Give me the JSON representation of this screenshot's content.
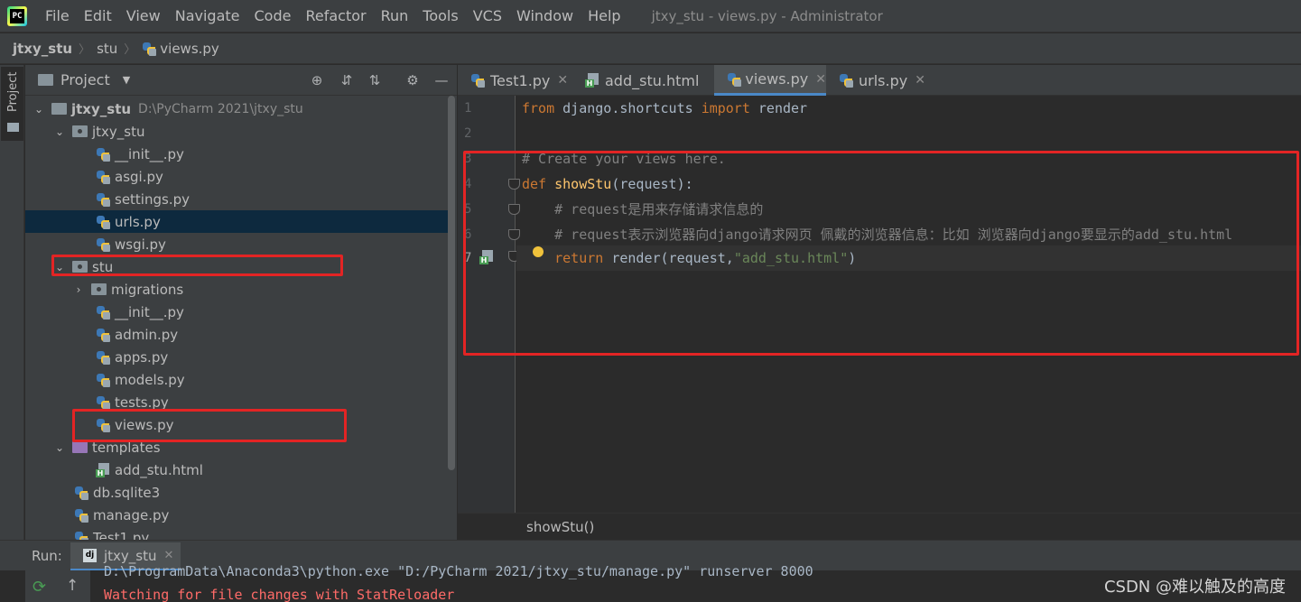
{
  "menubar": {
    "logo_icon": "pycharm-logo",
    "logo_text": "PC",
    "items": [
      "File",
      "Edit",
      "View",
      "Navigate",
      "Code",
      "Refactor",
      "Run",
      "Tools",
      "VCS",
      "Window",
      "Help"
    ],
    "window_title": "jtxy_stu - views.py - Administrator"
  },
  "breadcrumb": {
    "items": [
      "jtxy_stu",
      "stu",
      "views.py"
    ]
  },
  "left_stripe": {
    "label": "Project"
  },
  "project_panel": {
    "title": "Project",
    "tree": [
      {
        "label": "jtxy_stu",
        "path": "D:\\PyCharm 2021\\jtxy_stu",
        "icon": "folder-icon"
      },
      {
        "label": "jtxy_stu",
        "icon": "package-folder-icon"
      },
      {
        "label": "__init__.py",
        "icon": "python-file-icon"
      },
      {
        "label": "asgi.py",
        "icon": "python-file-icon"
      },
      {
        "label": "settings.py",
        "icon": "python-file-icon"
      },
      {
        "label": "urls.py",
        "icon": "python-file-icon",
        "selected": true
      },
      {
        "label": "wsgi.py",
        "icon": "python-file-icon"
      },
      {
        "label": "stu",
        "icon": "package-folder-icon"
      },
      {
        "label": "migrations",
        "icon": "package-folder-icon"
      },
      {
        "label": "__init__.py",
        "icon": "python-file-icon"
      },
      {
        "label": "admin.py",
        "icon": "python-file-icon"
      },
      {
        "label": "apps.py",
        "icon": "python-file-icon"
      },
      {
        "label": "models.py",
        "icon": "python-file-icon"
      },
      {
        "label": "tests.py",
        "icon": "python-file-icon"
      },
      {
        "label": "views.py",
        "icon": "python-file-icon"
      },
      {
        "label": "templates",
        "icon": "template-folder-icon"
      },
      {
        "label": "add_stu.html",
        "icon": "html-file-icon"
      },
      {
        "label": "db.sqlite3",
        "icon": "python-file-icon"
      },
      {
        "label": "manage.py",
        "icon": "python-file-icon"
      },
      {
        "label": "Test1.py",
        "icon": "python-file-icon"
      }
    ]
  },
  "editor_tabs": [
    {
      "label": "Test1.py",
      "icon": "python-file-icon"
    },
    {
      "label": "add_stu.html",
      "icon": "html-file-icon"
    },
    {
      "label": "views.py",
      "icon": "python-file-icon",
      "active": true
    },
    {
      "label": "urls.py",
      "icon": "python-file-icon"
    }
  ],
  "editor": {
    "line_numbers": [
      "1",
      "2",
      "3",
      "4",
      "5",
      "6",
      "7"
    ],
    "lines": {
      "l1": {
        "kw1": "from",
        "mod": " django.shortcuts ",
        "kw2": "import",
        "name": " render"
      },
      "l3": "# Create your views here.",
      "l4": {
        "kw": "def",
        "sp": " ",
        "fn": "showStu",
        "rest": "(request):"
      },
      "l5": "    # request是用来存储请求信息的",
      "l6": "    # request表示浏览器向django请求网页 佩戴的浏览器信息：比如 浏览器向django要显示的add_stu.html",
      "l7": {
        "indent": "    ",
        "kw": "return",
        "call": " render(request,",
        "str": "\"add_stu.html\"",
        "close": ")"
      }
    },
    "breadcrumb": "showStu()"
  },
  "run_panel": {
    "label": "Run:",
    "tab": "jtxy_stu",
    "tab_icon": "dj",
    "console": [
      "D:\\ProgramData\\Anaconda3\\python.exe \"D:/PyCharm 2021/jtxy_stu/manage.py\" runserver 8000",
      "Watching for file changes with StatReloader"
    ]
  },
  "watermark": "CSDN @难以触及的高度",
  "colors": {
    "background": "#2b2b2b",
    "panel": "#3c3f41",
    "keyword": "#cc7832",
    "function": "#ffc66d",
    "comment": "#808080",
    "string": "#6a8759",
    "selection": "#0d293e",
    "annotation": "#e32424",
    "console_error": "#ff6b68"
  }
}
